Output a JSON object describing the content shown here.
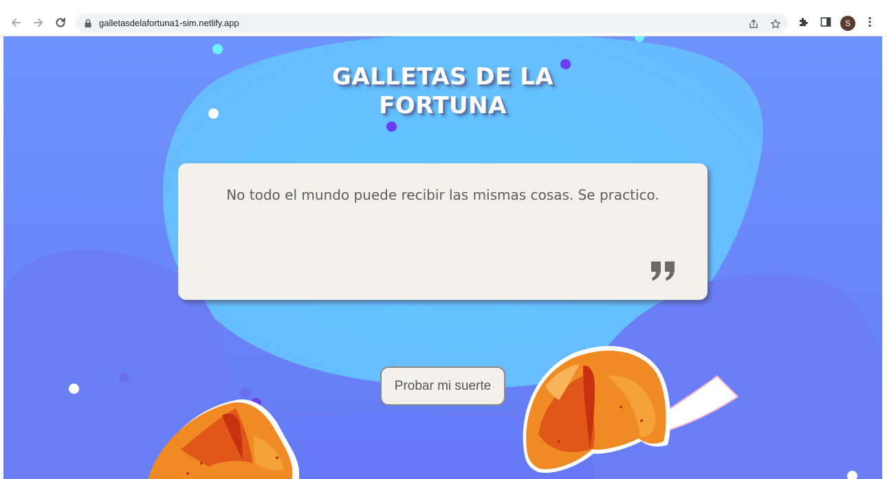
{
  "browser": {
    "url": "galletasdelafortuna1-sim.netlify.app",
    "profile_initial": "S",
    "icons": [
      "back-arrow-icon",
      "forward-arrow-icon",
      "reload-icon",
      "lock-icon",
      "share-icon",
      "star-icon",
      "extensions-puzzle-icon",
      "side-panel-icon",
      "more-vert-icon"
    ]
  },
  "page": {
    "title_line1": "GALLETAS DE LA",
    "title_line2": "FORTUNA",
    "quote": "No todo el mundo puede recibir las mismas cosas. Se practico.",
    "button_label": "Probar mi suerte",
    "decorations": [
      "closing-quote-icon",
      "fortune-cookie-left",
      "fortune-cookie-right-with-paper",
      "confetti-dots"
    ]
  },
  "colors": {
    "background": "#6a86f8",
    "blob_light": "#64c3fe",
    "card": "#f2f1ec",
    "text": "#5d5d5d",
    "cookie_orange": "#f08a24",
    "dot_cyan": "#6ff2ff",
    "dot_purple": "#6a3df0"
  }
}
